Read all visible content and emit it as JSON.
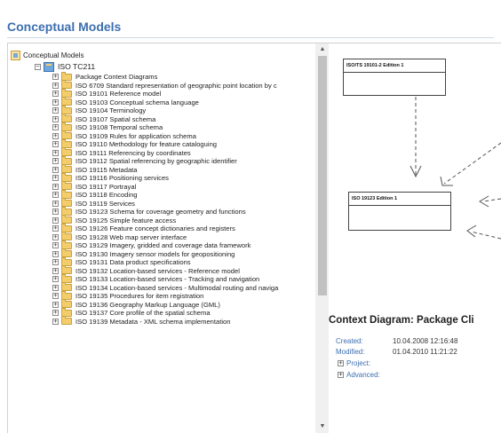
{
  "page": {
    "title": "Conceptual Models"
  },
  "tree": {
    "root": {
      "label": "Conceptual Models"
    },
    "package": {
      "label": "ISO TC211"
    },
    "items": [
      "Package Context Diagrams",
      "ISO 6709 Standard representation of geographic point location by c",
      "ISO 19101 Reference model",
      "ISO 19103 Conceptual schema language",
      "ISO 19104 Terminology",
      "ISO 19107 Spatial schema",
      "ISO 19108 Temporal schema",
      "ISO 19109 Rules for application schema",
      "ISO 19110 Methodology for feature cataloguing",
      "ISO 19111 Referencing by coordinates",
      "ISO 19112 Spatial referencing by geographic identifier",
      "ISO 19115 Metadata",
      "ISO 19116 Positioning services",
      "ISO 19117 Portrayal",
      "ISO 19118 Encoding",
      "ISO 19119 Services",
      "ISO 19123 Schema for coverage geometry and functions",
      "ISO 19125 Simple feature access",
      "ISO 19126 Feature concept dictionaries and registers",
      "ISO 19128 Web map server interface",
      "ISO 19129 Imagery, gridded and coverage data framework",
      "ISO 19130 Imagery sensor models for geopositioning",
      "ISO 19131 Data product specifications",
      "ISO 19132 Location-based services - Reference model",
      "ISO 19133 Location-based services - Tracking and navigation",
      "ISO 19134 Location-based services - Multimodal routing and naviga",
      "ISO 19135 Procedures for item registration",
      "ISO 19136 Geography Markup Language (GML)",
      "ISO 19137 Core profile of the spatial schema",
      "ISO 19139 Metadata - XML schema implementation"
    ]
  },
  "diagram": {
    "box_top_label": "ISO/TS 19101-2 Edition 1",
    "box_mid_label": "ISO 19123 Edition 1"
  },
  "details": {
    "title": "Context Diagram: Package Cli",
    "created_label": "Created:",
    "created_value": "10.04.2008 12:16:48",
    "modified_label": "Modified:",
    "modified_value": "01.04.2010 11:21:22",
    "project_label": "Project:",
    "advanced_label": "Advanced:"
  },
  "colors": {
    "accent": "#3d6fb0",
    "folder": "#f3cd6c"
  },
  "icons": {
    "expander": "plus-box",
    "collapse": "minus-box",
    "folder": "folder-icon"
  }
}
